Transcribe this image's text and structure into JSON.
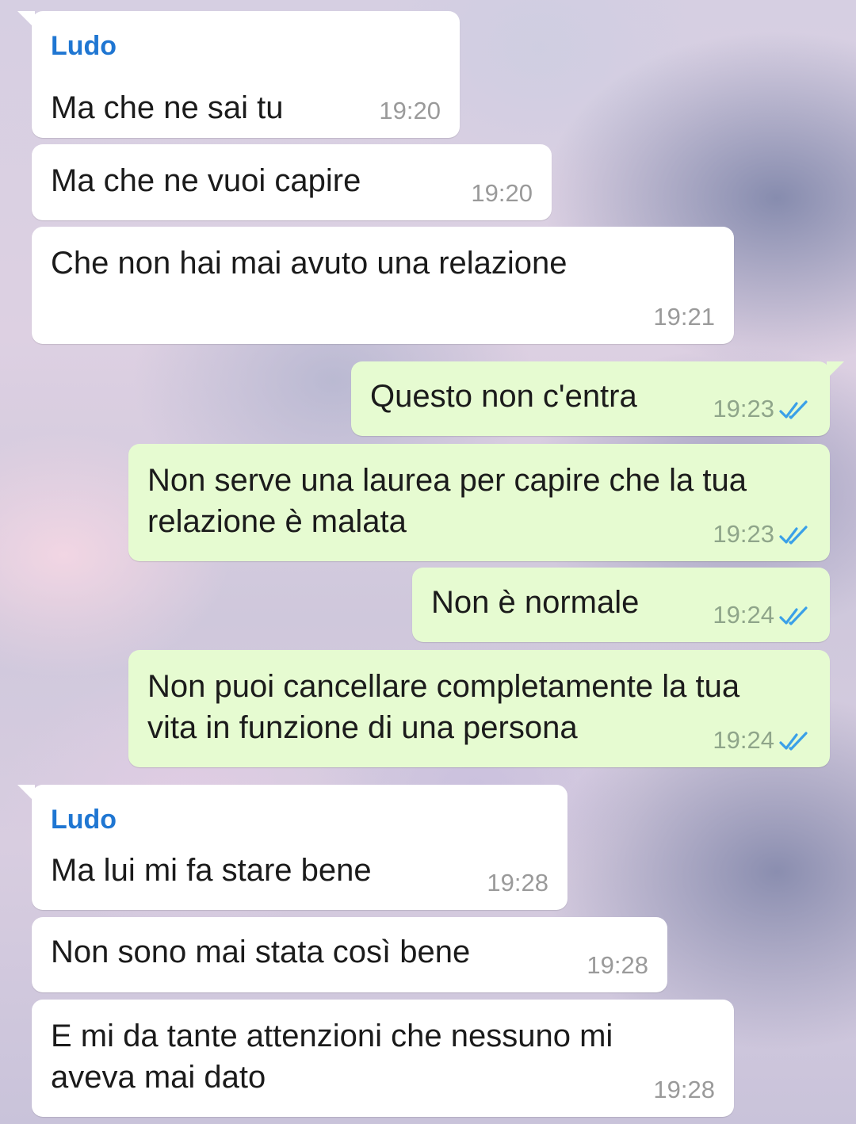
{
  "accent_colors": {
    "sender_name": "#1f76d2",
    "incoming_bubble": "#ffffff",
    "outgoing_bubble": "#e6fbd1",
    "read_ticks": "#3aa0e8"
  },
  "messages": [
    {
      "direction": "in",
      "sender": "Ludo",
      "lines": [
        "Ma che ne sai tu"
      ],
      "time": "19:20"
    },
    {
      "direction": "in",
      "lines": [
        "Ma che ne vuoi capire"
      ],
      "time": "19:20"
    },
    {
      "direction": "in",
      "lines": [
        "Che non hai mai avuto una relazione"
      ],
      "time": "19:21"
    },
    {
      "direction": "out",
      "lines": [
        "Questo non c'entra"
      ],
      "time": "19:23",
      "status_icon": "double-check-read-icon"
    },
    {
      "direction": "out",
      "lines": [
        "Non serve una laurea per capire che la tua",
        "relazione è malata"
      ],
      "time": "19:23",
      "status_icon": "double-check-read-icon"
    },
    {
      "direction": "out",
      "lines": [
        "Non è normale"
      ],
      "time": "19:24",
      "status_icon": "double-check-read-icon"
    },
    {
      "direction": "out",
      "lines": [
        "Non puoi cancellare completamente la tua",
        "vita in funzione di una persona"
      ],
      "time": "19:24",
      "status_icon": "double-check-read-icon"
    },
    {
      "direction": "in",
      "sender": "Ludo",
      "lines": [
        "Ma lui mi fa stare bene"
      ],
      "time": "19:28"
    },
    {
      "direction": "in",
      "lines": [
        "Non sono mai stata così bene"
      ],
      "time": "19:28"
    },
    {
      "direction": "in",
      "lines": [
        "E mi da tante attenzioni che nessuno mi",
        "aveva mai dato"
      ],
      "time": "19:28"
    }
  ]
}
